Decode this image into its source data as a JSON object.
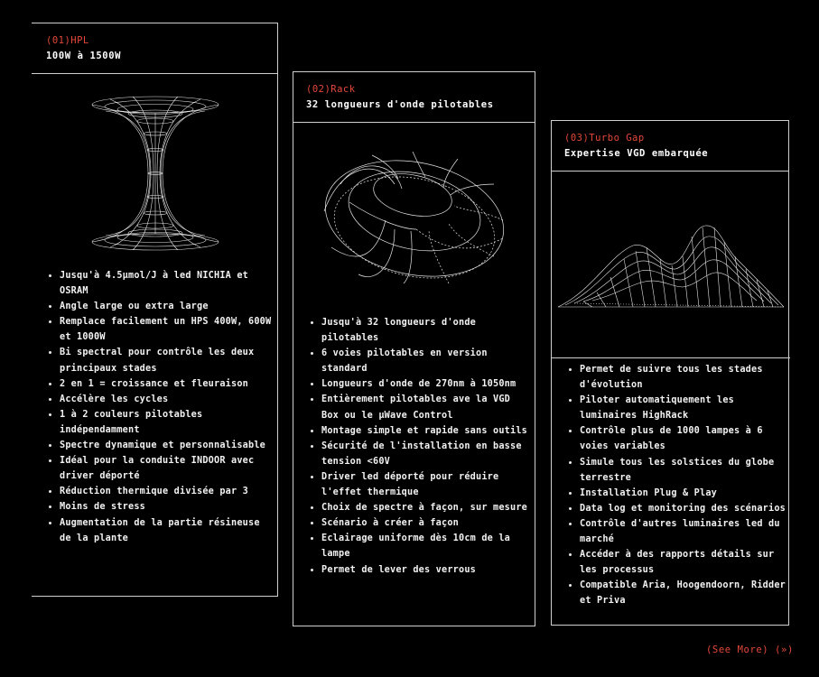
{
  "cards": [
    {
      "number": "(01)HPL",
      "subtitle": "100W à 1500W",
      "illustration": "hourglass-wireframe-icon",
      "items": [
        "Jusqu'à 4.5µmol/J à led NICHIA et OSRAM",
        "Angle large ou extra large",
        "Remplace facilement un HPS 400W, 600W et 1000W",
        "Bi spectral pour contrôle les deux principaux stades",
        "2 en 1 = croissance et fleuraison",
        "Accélère les cycles",
        "1 à 2 couleurs pilotables indépendamment",
        "Spectre dynamique et personnalisable",
        "Idéal pour la conduite INDOOR avec driver déporté",
        "Réduction thermique divisée par 3",
        "Moins de stress",
        "Augmentation de la partie résineuse de la plante"
      ]
    },
    {
      "number": "(02)Rack",
      "subtitle": "32 longueurs d'onde pilotables",
      "illustration": "torus-wireframe-icon",
      "items": [
        "Jusqu'à 32 longueurs d'onde pilotables",
        "6 voies pilotables en version standard",
        "Longueurs d'onde de 270nm à 1050nm",
        "Entièrement pilotables ave la VGD Box ou le µWave Control",
        "Montage simple et rapide sans outils",
        "Sécurité de l'installation en basse tension <60V",
        "Driver led déporté pour réduire l'effet thermique",
        "Choix de spectre à façon, sur mesure",
        "Scénario à créer à façon",
        "Eclairage uniforme dès 10cm de la lampe",
        "Permet de lever des verrous"
      ]
    },
    {
      "number": "(03)Turbo Gap",
      "subtitle": "Expertise VGD embarquée",
      "illustration": "terrain-wireframe-icon",
      "items": [
        "Permet de suivre tous les stades d'évolution",
        "Piloter automatiquement les luminaires HighRack",
        "Contrôle plus de 1000 lampes à 6 voies variables",
        "Simule tous les solstices du globe terrestre",
        "Installation Plug & Play",
        "Data log et monitoring des scénarios",
        "Contrôle d'autres luminaires led du marché",
        "Accéder à des rapports détails sur les processus",
        "Compatible Aria, Hoogendoorn, Ridder et Priva"
      ]
    }
  ],
  "see_more": {
    "label": "(See More)",
    "arrow": "(»)"
  },
  "colors": {
    "background": "#000000",
    "accent": "#e5483a",
    "text": "#ffffff",
    "border": "#cfcfcf"
  }
}
